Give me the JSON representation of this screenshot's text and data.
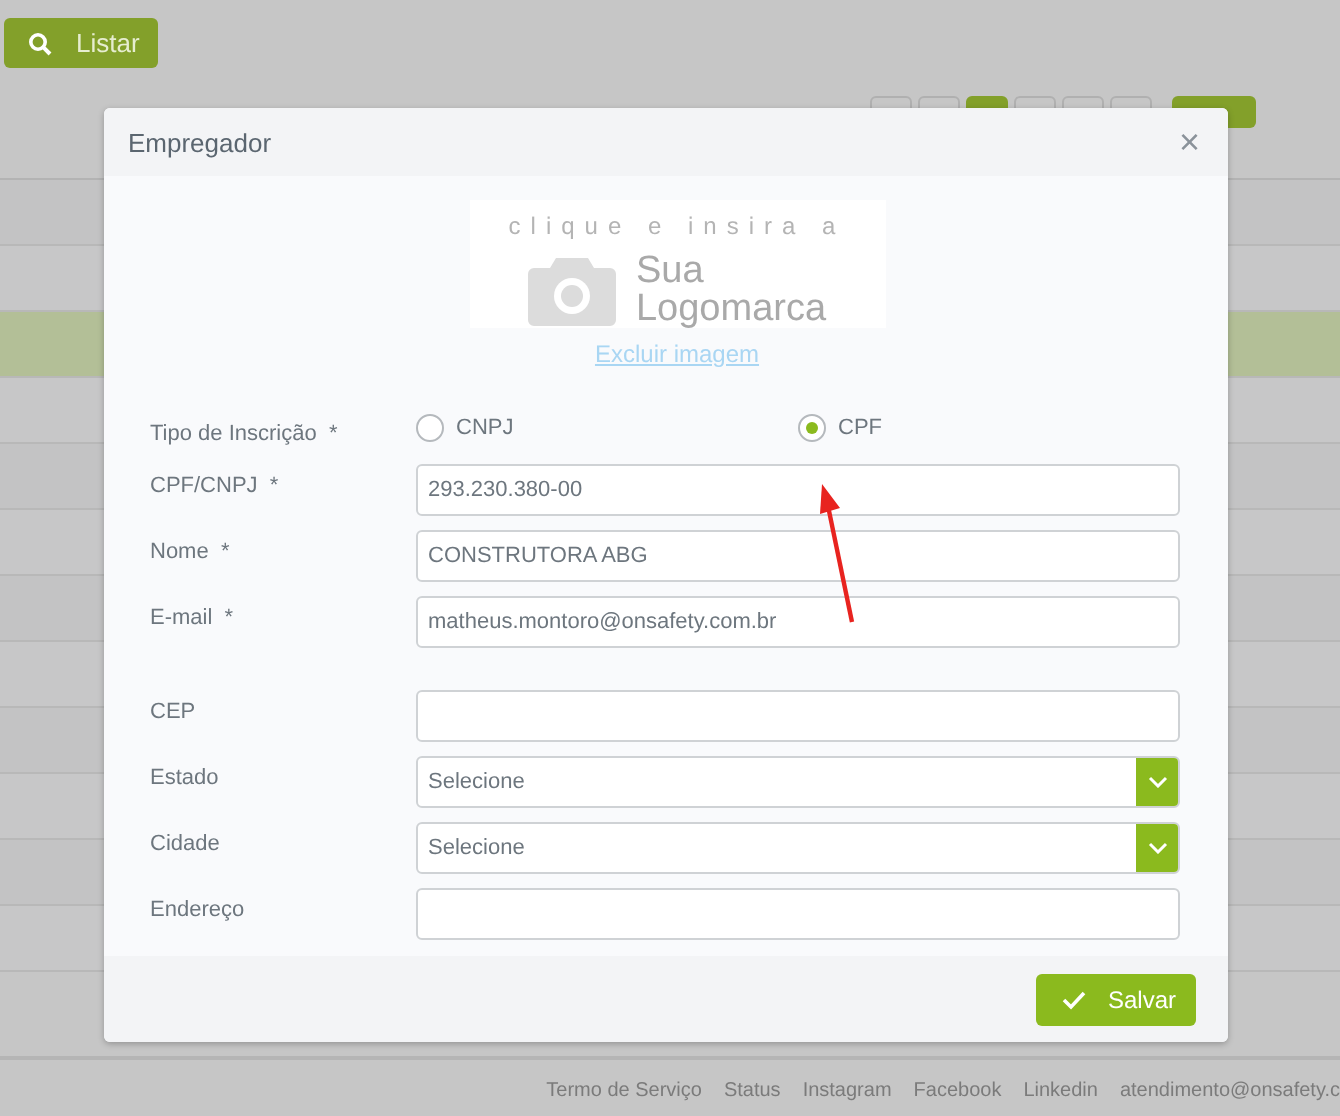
{
  "toolbar": {
    "list_button": "Listar"
  },
  "pagination": [
    {
      "selected": false
    },
    {
      "selected": false
    },
    {
      "selected": true
    },
    {
      "selected": false
    },
    {
      "selected": false
    },
    {
      "selected": false
    }
  ],
  "table_rows": [
    {
      "selected": false
    },
    {
      "selected": false
    },
    {
      "selected": true
    },
    {
      "selected": false
    },
    {
      "selected": false
    },
    {
      "selected": false
    },
    {
      "selected": false
    },
    {
      "selected": false
    },
    {
      "selected": false
    },
    {
      "selected": false
    },
    {
      "selected": false
    },
    {
      "selected": false
    }
  ],
  "dialog": {
    "title": "Empregador",
    "close": "×",
    "logo": {
      "tagline": "clique e insira a",
      "line1": "Sua",
      "line2": "Logomarca"
    },
    "remove_link": "Excluir imagem",
    "sections": [
      [
        {
          "kind": "radio",
          "label": "Tipo de Inscrição  *",
          "options": [
            {
              "label": "CNPJ",
              "selected": false
            },
            {
              "label": "CPF",
              "selected": true
            }
          ]
        },
        {
          "kind": "text",
          "label": "CPF/CNPJ  *",
          "value": "293.230.380-00"
        },
        {
          "kind": "text",
          "label": "Nome  *",
          "value": "CONSTRUTORA ABG"
        },
        {
          "kind": "text",
          "label": "E-mail  *",
          "value": "matheus.montoro@onsafety.com.br"
        }
      ],
      [
        {
          "kind": "text",
          "label": "CEP"
        },
        {
          "kind": "select",
          "label": "Estado",
          "value": "Selecione"
        },
        {
          "kind": "select",
          "label": "Cidade",
          "value": "Selecione"
        },
        {
          "kind": "text",
          "label": "Endereço"
        }
      ]
    ],
    "save_button": "Salvar"
  },
  "footer_links": [
    "Termo de Serviço",
    "Status",
    "Instagram",
    "Facebook",
    "Linkedin",
    "atendimento@onsafety.c"
  ]
}
